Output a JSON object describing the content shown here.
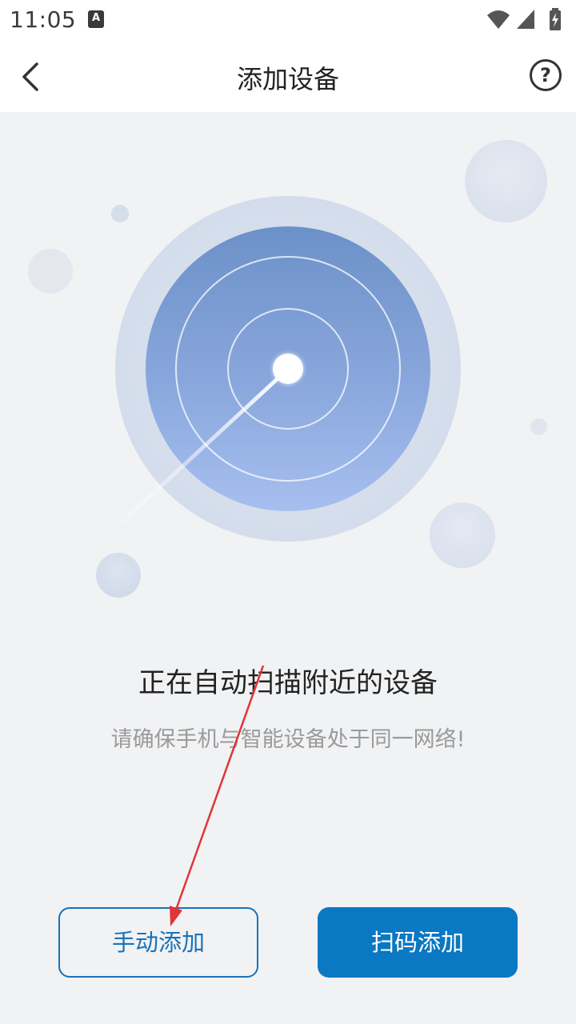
{
  "status_bar": {
    "time": "11:05",
    "app_icon_letter": "A",
    "icons": [
      "wifi-icon",
      "signal-icon",
      "battery-charging-icon"
    ]
  },
  "header": {
    "title": "添加设备",
    "back_icon": "chevron-left-icon",
    "help_icon": "question-circle-icon",
    "help_glyph": "?"
  },
  "radar": {
    "icon": "radar-scan-graphic"
  },
  "message": {
    "title": "正在自动扫描附近的设备",
    "subtitle": "请确保手机与智能设备处于同一网络!"
  },
  "buttons": {
    "manual_add": "手动添加",
    "scan_add": "扫码添加"
  },
  "colors": {
    "accent": "#0a78c2",
    "background": "#f1f2f4",
    "annotation_arrow": "#e0343a"
  }
}
